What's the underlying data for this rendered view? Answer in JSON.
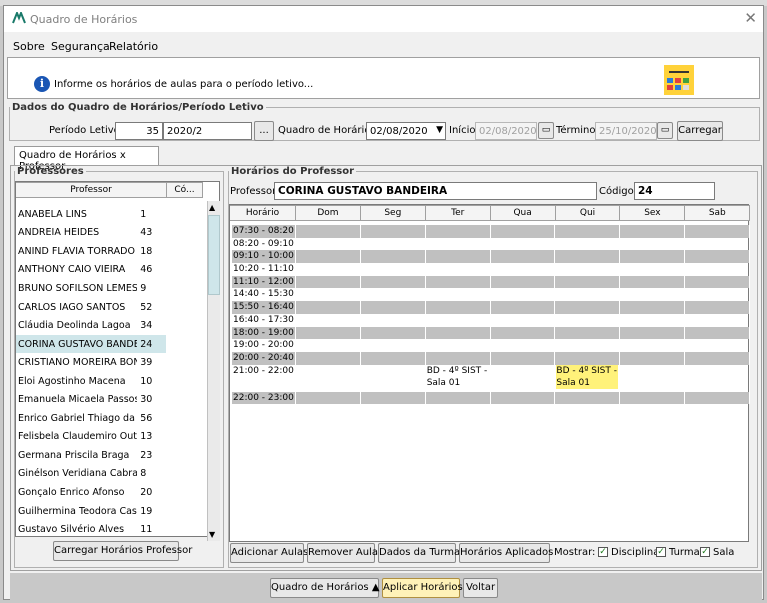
{
  "window": {
    "title": "Quadro de Horários",
    "close": "✕"
  },
  "menu": [
    "Sobre",
    "Segurança",
    "Relatório"
  ],
  "info": {
    "text": "Informe os horários de aulas para o período letivo...",
    "icon": "info-icon"
  },
  "dados": {
    "legend": "Dados do Quadro de Horários/Período Letivo",
    "periodo_label": "Período Letivo:",
    "periodo_num": "35",
    "periodo_val": "2020/2",
    "quadro_label": "Quadro de Horários:",
    "quadro_val": "02/08/2020",
    "inicio_label": "Início:",
    "inicio_val": "02/08/2020",
    "termino_label": "Término:",
    "termino_val": "25/10/2020",
    "carregar": "Carregar",
    "ellipsis": "..."
  },
  "tab": {
    "label": "Quadro de Horários x Professor"
  },
  "professores": {
    "legend": "Professores",
    "col_prof": "Professor",
    "col_cod": "Có...",
    "rows": [
      {
        "name": "ANABELA LINS",
        "code": "1"
      },
      {
        "name": "ANDREIA HEIDES",
        "code": "43"
      },
      {
        "name": "ANIND FLÁVIA TORRADO",
        "code": "18"
      },
      {
        "name": "ANTHONY CAIO VIEIRA",
        "code": "46"
      },
      {
        "name": "BRUNO SOFILSON LEMES",
        "code": "9"
      },
      {
        "name": "CARLOS IAGO SANTOS",
        "code": "52"
      },
      {
        "name": "Cláudia Deolinda Lagoa",
        "code": "34"
      },
      {
        "name": "CORINA GUSTAVO BANDEIRA",
        "code": "24"
      },
      {
        "name": "CRISTIANO MOREIRA BONETTI",
        "code": "39"
      },
      {
        "name": "Eloi Agostinho Macena",
        "code": "10"
      },
      {
        "name": "Emanuela Micaela Passos",
        "code": "30"
      },
      {
        "name": "Enrico Gabriel Thiago da Silva",
        "code": "56"
      },
      {
        "name": "Felisbela Claudemiro Outeiro",
        "code": "13"
      },
      {
        "name": "Germana Priscila Braga",
        "code": "23"
      },
      {
        "name": "Ginélson Veridiana Cabral",
        "code": "8"
      },
      {
        "name": "Gonçalo Enrico Afonso",
        "code": "20"
      },
      {
        "name": "Guilhermina Teodora Castanho",
        "code": "19"
      },
      {
        "name": "Gustavo Silvério Alves",
        "code": "11"
      }
    ],
    "selected_index": 7,
    "carregar_btn": "Carregar Horários Professor"
  },
  "horarios": {
    "legend": "Horários do Professor",
    "prof_label": "Professor:",
    "prof_val": "CORINA GUSTAVO BANDEIRA",
    "cod_label": "Código:",
    "cod_val": "24",
    "cols": [
      "Horário",
      "Dom",
      "Seg",
      "Ter",
      "Qua",
      "Qui",
      "Sex",
      "Sab"
    ],
    "rows": [
      {
        "time": "07:30 - 08:20",
        "gray": true
      },
      {
        "time": "08:20 - 09:10",
        "gray": false
      },
      {
        "time": "09:10 - 10:00",
        "gray": true
      },
      {
        "time": "10:20 - 11:10",
        "gray": false
      },
      {
        "time": "11:10 - 12:00",
        "gray": true
      },
      {
        "time": "14:40 - 15:30",
        "gray": false
      },
      {
        "time": "15:50 - 16:40",
        "gray": true
      },
      {
        "time": "16:40 - 17:30",
        "gray": false
      },
      {
        "time": "18:00 - 19:00",
        "gray": true
      },
      {
        "time": "19:00 - 20:00",
        "gray": false
      },
      {
        "time": "20:00 - 20:40",
        "gray": true
      },
      {
        "time": "21:00 - 22:00",
        "gray": false,
        "tall": true
      },
      {
        "time": "22:00 - 23:00",
        "gray": true
      }
    ],
    "cell_ter": "BD - 4º SIST - Sala 01",
    "cell_qui": "BD - 4º SIST - Sala 01",
    "buttons": [
      "Adicionar Aulas",
      "Remover Aula",
      "Dados da Turma",
      "Horários Aplicados"
    ],
    "mostrar_label": "Mostrar:",
    "checks": [
      "Disciplina",
      "Turma",
      "Sala"
    ]
  },
  "footer": {
    "quadro": "Quadro de Horários ▲",
    "aplicar": "Aplicar Horários",
    "voltar": "Voltar"
  }
}
